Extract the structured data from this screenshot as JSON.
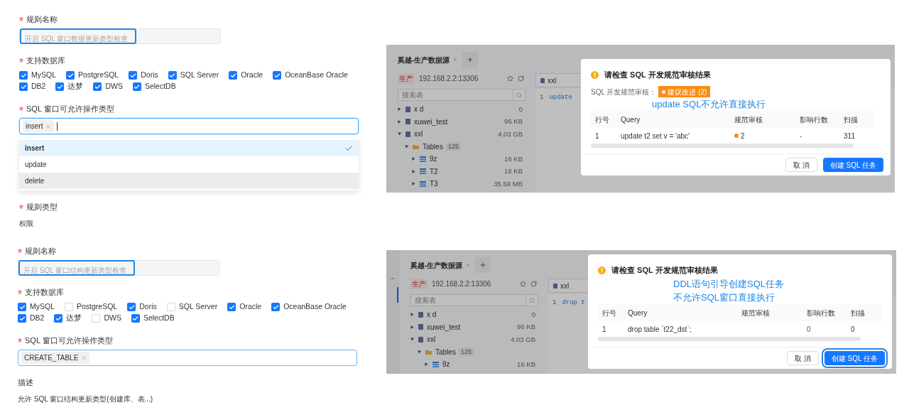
{
  "sections": [
    {
      "form": {
        "fields": [
          {
            "kind": "input",
            "label": "规则名称",
            "required": true,
            "placeholder": "开启 SQL 窗口数据更新类型检查",
            "highlighted": true
          },
          {
            "kind": "checkboxes",
            "label": "支持数据库",
            "required": true,
            "options": [
              {
                "label": "MySQL",
                "checked": true
              },
              {
                "label": "PostgreSQL",
                "checked": true
              },
              {
                "label": "Doris",
                "checked": true
              },
              {
                "label": "SQL Server",
                "checked": true
              },
              {
                "label": "Oracle",
                "checked": true
              },
              {
                "label": "OceanBase Oracle",
                "checked": true
              },
              {
                "label": "DB2",
                "checked": true
              },
              {
                "label": "达梦",
                "checked": true
              },
              {
                "label": "DWS",
                "checked": true
              },
              {
                "label": "SelectDB",
                "checked": true
              }
            ]
          },
          {
            "kind": "tags",
            "label": "SQL 窗口可允许操作类型",
            "required": true,
            "focused": true,
            "tags": [
              "insert"
            ],
            "dropdown": [
              {
                "label": "insert",
                "selected": true,
                "hovered": false
              },
              {
                "label": "update",
                "selected": false,
                "hovered": false
              },
              {
                "label": "delete",
                "selected": false,
                "hovered": true
              }
            ]
          },
          {
            "kind": "text",
            "label": "规则类型",
            "required": true,
            "value": "权限"
          }
        ]
      },
      "screenshot": {
        "side_rail": false,
        "tab": "奚越-生产数据源",
        "env": "生产",
        "host": "192.168.2.2:13306",
        "search_placeholder": "搜索表",
        "tree": [
          {
            "kind": "database",
            "name": "x d",
            "size": "0",
            "expanded": false
          },
          {
            "kind": "database",
            "name": "xuwei_test",
            "size": "96 KB",
            "expanded": false
          },
          {
            "kind": "database",
            "name": "xxl",
            "size": "4.03 GB",
            "expanded": true,
            "children": [
              {
                "kind": "folder",
                "name": "Tables",
                "count": "125",
                "expanded": true,
                "children": [
                  {
                    "kind": "table",
                    "name": "9z",
                    "size": "16 KB",
                    "expanded": false
                  },
                  {
                    "kind": "table",
                    "name": "T2",
                    "size": "16 KB",
                    "expanded": false
                  },
                  {
                    "kind": "table",
                    "name": "T3",
                    "size": "35.59 MB",
                    "expanded": false
                  }
                ]
              }
            ]
          }
        ],
        "editor_tab": "xxl",
        "code_lines": [
          {
            "number": "1",
            "code": "update"
          }
        ],
        "dialog": {
          "title": "请检查 SQL 开发规范审核结果",
          "audit": {
            "label": "SQL 开发规范审核：",
            "badge": "建议改进 (2)"
          },
          "annotation": [
            "update SQL不允许直接执行"
          ],
          "columns": [
            "行号",
            "Query",
            "规范审核",
            "影响行数",
            "扫描"
          ],
          "rows": [
            {
              "line": "1",
              "query": "update t2 set v = 'abc'",
              "audit_count": "2",
              "affected": "-",
              "scanned": "311"
            }
          ],
          "buttons": [
            {
              "label": "取 消",
              "kind": "default",
              "highlighted": false
            },
            {
              "label": "创建 SQL 任务",
              "kind": "primary",
              "highlighted": false
            }
          ]
        }
      }
    },
    {
      "form": {
        "fields": [
          {
            "kind": "input",
            "label": "规则名称",
            "required": true,
            "placeholder": "开启 SQL 窗口结构更新类型检查",
            "highlighted": true
          },
          {
            "kind": "checkboxes",
            "label": "支持数据库",
            "required": true,
            "options": [
              {
                "label": "MySQL",
                "checked": true
              },
              {
                "label": "PostgreSQL",
                "checked": false
              },
              {
                "label": "Doris",
                "checked": true
              },
              {
                "label": "SQL Server",
                "checked": false
              },
              {
                "label": "Oracle",
                "checked": true
              },
              {
                "label": "OceanBase Oracle",
                "checked": true
              },
              {
                "label": "DB2",
                "checked": true
              },
              {
                "label": "达梦",
                "checked": true
              },
              {
                "label": "DWS",
                "checked": false
              },
              {
                "label": "SelectDB",
                "checked": true
              }
            ]
          },
          {
            "kind": "tags",
            "label": "SQL 窗口可允许操作类型",
            "required": true,
            "focused": false,
            "tags": [
              "CREATE_TABLE"
            ]
          },
          {
            "kind": "text",
            "label": "描述",
            "required": false,
            "value": "允许 SQL 窗口结构更新类型(创建库、表...)"
          }
        ]
      },
      "screenshot": {
        "side_rail": true,
        "tab": "奚越-生产数据源",
        "env": "生产",
        "host": "192.168.2.2:13306",
        "search_placeholder": "搜索表",
        "tree": [
          {
            "kind": "database",
            "name": "x d",
            "size": "0",
            "expanded": false
          },
          {
            "kind": "database",
            "name": "xuwei_test",
            "size": "96 KB",
            "expanded": false
          },
          {
            "kind": "database",
            "name": "xxl",
            "size": "4.03 GB",
            "expanded": true,
            "children": [
              {
                "kind": "folder",
                "name": "Tables",
                "count": "125",
                "expanded": true,
                "children": [
                  {
                    "kind": "table",
                    "name": "9z",
                    "size": "16 KB",
                    "expanded": false
                  }
                ]
              }
            ]
          }
        ],
        "editor_tab": "xxl",
        "code_lines": [
          {
            "number": "1",
            "code": "drop t"
          }
        ],
        "dialog": {
          "title": "请检查 SQL 开发规范审核结果",
          "annotation": [
            "DDL语句引导创建SQL任务",
            "不允许SQL窗口直接执行"
          ],
          "columns": [
            "行号",
            "Query",
            "规范审核",
            "影响行数",
            "扫描"
          ],
          "rows": [
            {
              "line": "1",
              "query": "drop table `t22_dst`;",
              "affected": "0",
              "scanned": "0"
            }
          ],
          "buttons": [
            {
              "label": "取 消",
              "kind": "default",
              "highlighted": false
            },
            {
              "label": "创建 SQL 任务",
              "kind": "primary",
              "highlighted": true
            }
          ]
        }
      }
    }
  ]
}
